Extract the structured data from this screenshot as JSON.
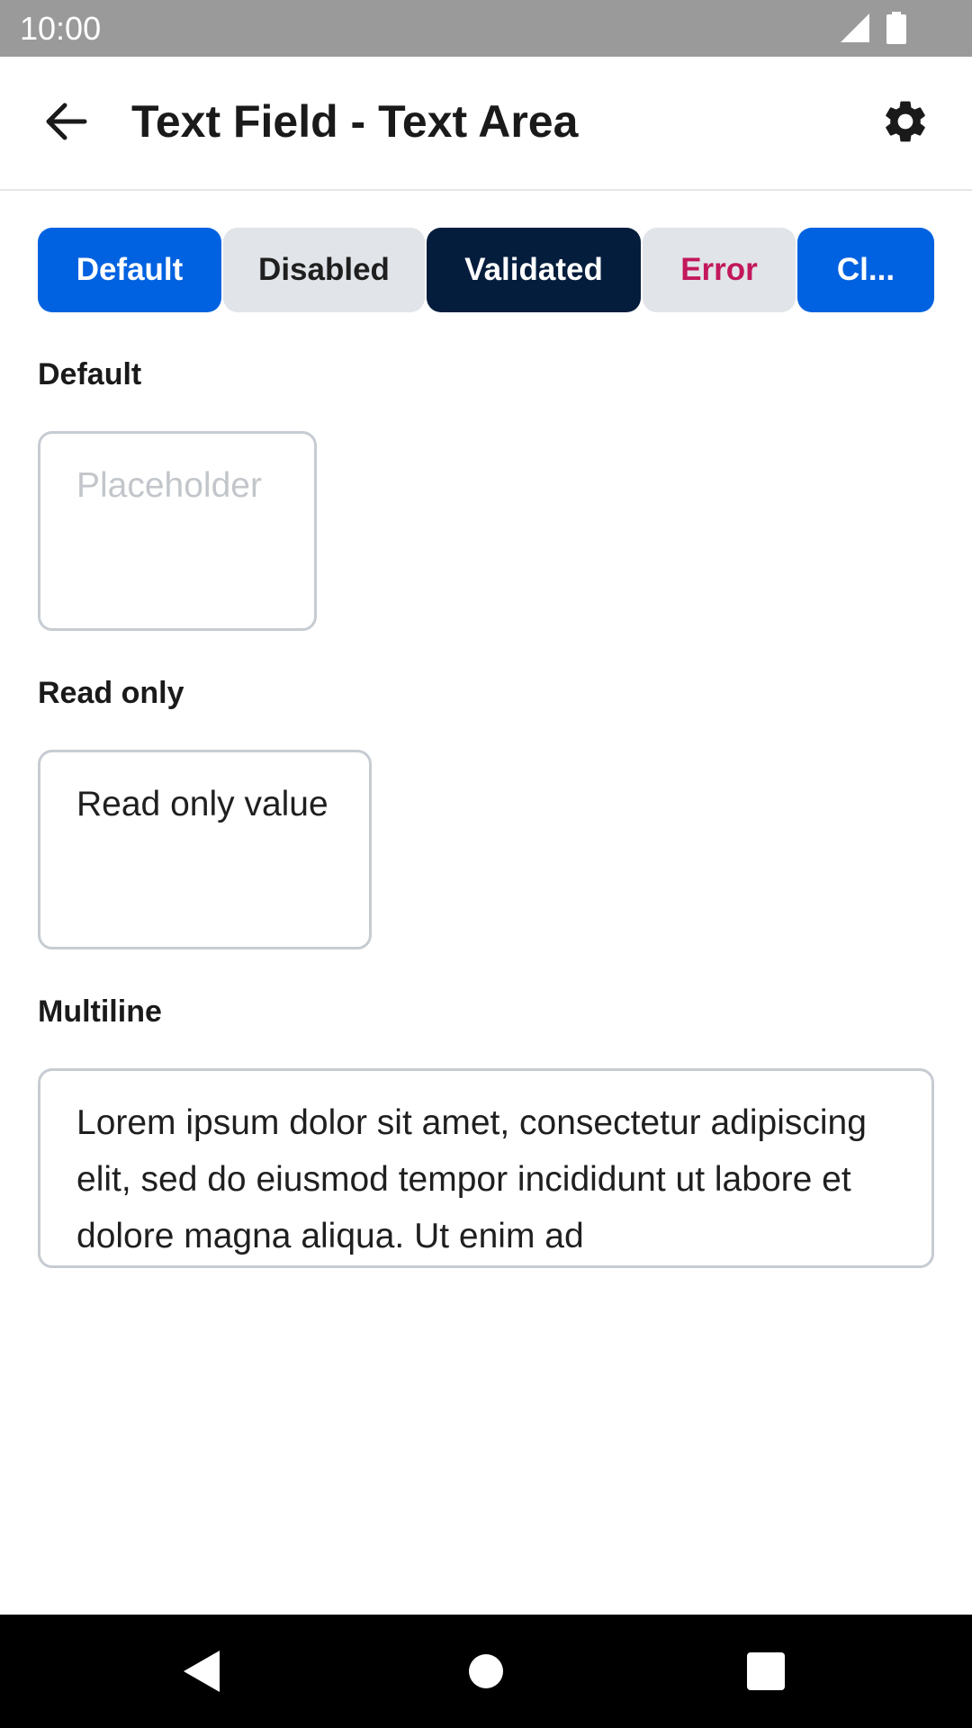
{
  "status_bar": {
    "time": "10:00"
  },
  "app_bar": {
    "title": "Text Field - Text Area"
  },
  "tabs": [
    {
      "label": "Default"
    },
    {
      "label": "Disabled"
    },
    {
      "label": "Validated"
    },
    {
      "label": "Error"
    },
    {
      "label": "Cl..."
    }
  ],
  "sections": {
    "default": {
      "label": "Default",
      "placeholder": "Placeholder"
    },
    "read_only": {
      "label": "Read only",
      "value": "Read only value"
    },
    "multiline": {
      "label": "Multiline",
      "value": "Lorem ipsum dolor sit amet, consectetur adipiscing elit, sed do eiusmod tempor incididunt ut labore et dolore magna aliqua. Ut enim ad"
    }
  },
  "colors": {
    "primary": "#0062e0",
    "validated": "#051d3d",
    "error_text": "#c2185b",
    "tab_neutral": "#e1e4e8"
  }
}
